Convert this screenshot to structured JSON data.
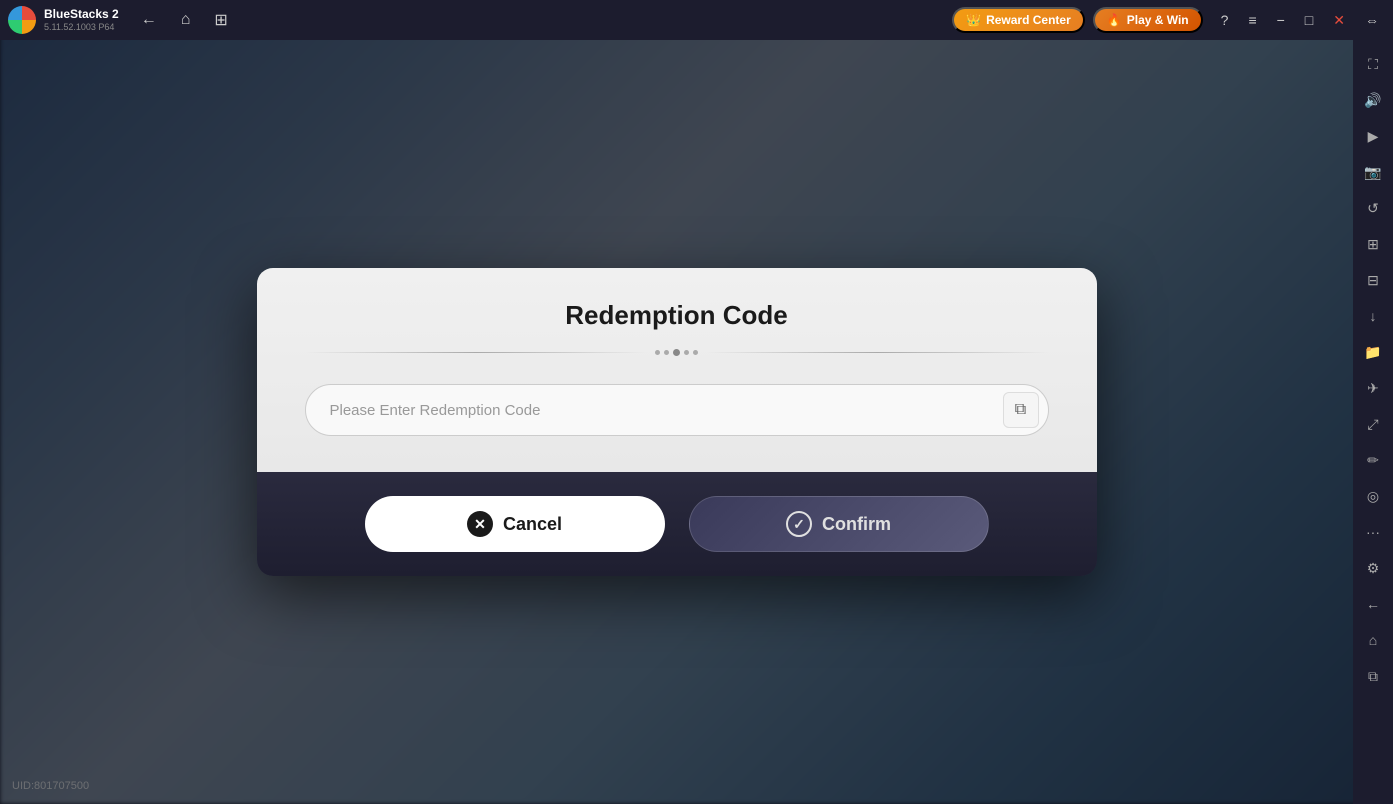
{
  "app": {
    "name": "BlueStacks 2",
    "version": "5.11.52.1003  P64",
    "logo_alt": "bluestacks-logo"
  },
  "titlebar": {
    "back_label": "←",
    "home_label": "⌂",
    "multi_label": "⊞",
    "reward_label": "Reward Center",
    "play_win_label": "Play & Win",
    "help_label": "?",
    "menu_label": "≡",
    "minimize_label": "−",
    "restore_label": "□",
    "close_label": "✕",
    "expand_label": "⇔"
  },
  "sidebar": {
    "icons": [
      {
        "name": "fullscreen-icon",
        "glyph": "⛶"
      },
      {
        "name": "volume-icon",
        "glyph": "🔊"
      },
      {
        "name": "video-icon",
        "glyph": "▶"
      },
      {
        "name": "screenshot-icon",
        "glyph": "📷"
      },
      {
        "name": "rotate-icon",
        "glyph": "↺"
      },
      {
        "name": "timer-icon",
        "glyph": "⏱"
      },
      {
        "name": "apps-icon",
        "glyph": "⊞"
      },
      {
        "name": "download-icon",
        "glyph": "↓"
      },
      {
        "name": "folder-icon",
        "glyph": "📁"
      },
      {
        "name": "airplane-icon",
        "glyph": "✈"
      },
      {
        "name": "resize-icon",
        "glyph": "⤢"
      },
      {
        "name": "brush-icon",
        "glyph": "✏"
      },
      {
        "name": "pin-icon",
        "glyph": "📍"
      },
      {
        "name": "more-icon",
        "glyph": "···"
      },
      {
        "name": "settings-icon",
        "glyph": "⚙"
      },
      {
        "name": "back-icon",
        "glyph": "←"
      },
      {
        "name": "home2-icon",
        "glyph": "⌂"
      },
      {
        "name": "recent-icon",
        "glyph": "⧉"
      }
    ]
  },
  "uid": {
    "label": "UID:801707500"
  },
  "modal": {
    "title": "Redemption Code",
    "input_placeholder": "Please Enter Redemption Code",
    "cancel_label": "Cancel",
    "confirm_label": "Confirm"
  }
}
